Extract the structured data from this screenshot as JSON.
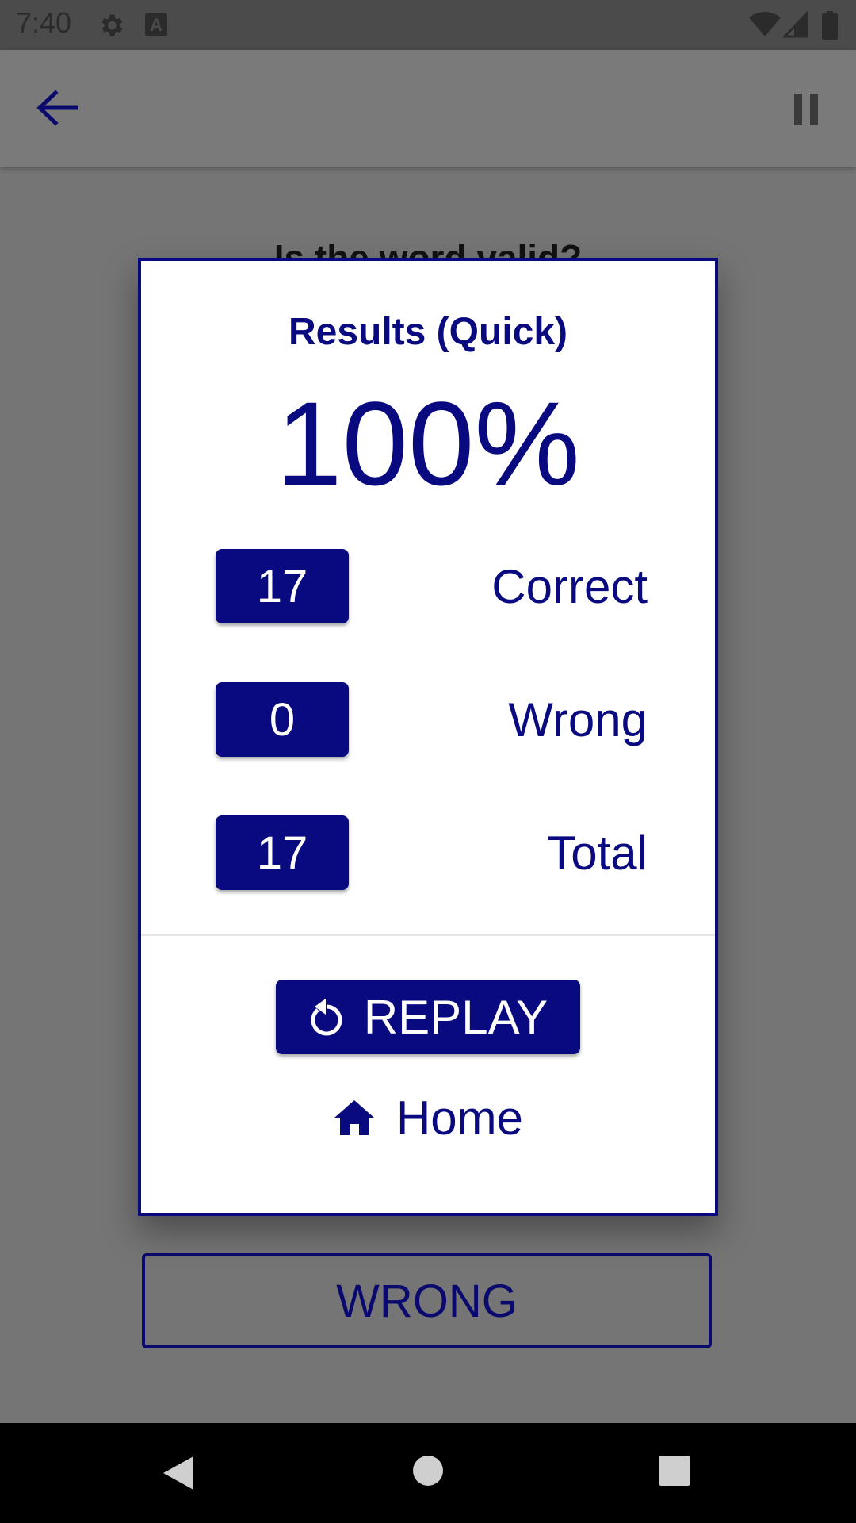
{
  "status_bar": {
    "time": "7:40",
    "icons": [
      "settings-icon",
      "keyboard-a-icon",
      "wifi-icon",
      "signal-icon",
      "battery-icon"
    ]
  },
  "app_bar": {
    "back_icon": "arrow-back-icon",
    "pause_icon": "pause-icon"
  },
  "background": {
    "question_text": "Is the word valid?",
    "wrong_button_label": "WRONG"
  },
  "dialog": {
    "title": "Results (Quick)",
    "percent": "100%",
    "stats": [
      {
        "value": "17",
        "label": "Correct"
      },
      {
        "value": "0",
        "label": "Wrong"
      },
      {
        "value": "17",
        "label": "Total"
      }
    ],
    "replay_label": "REPLAY",
    "replay_icon": "replay-icon",
    "home_label": "Home",
    "home_icon": "home-icon"
  },
  "nav_bar": {
    "icons": [
      "nav-back-icon",
      "nav-home-icon",
      "nav-recents-icon"
    ]
  },
  "colors": {
    "accent": "#0a0a80",
    "dialog_background": "#ffffff",
    "scrim": "#757575"
  }
}
